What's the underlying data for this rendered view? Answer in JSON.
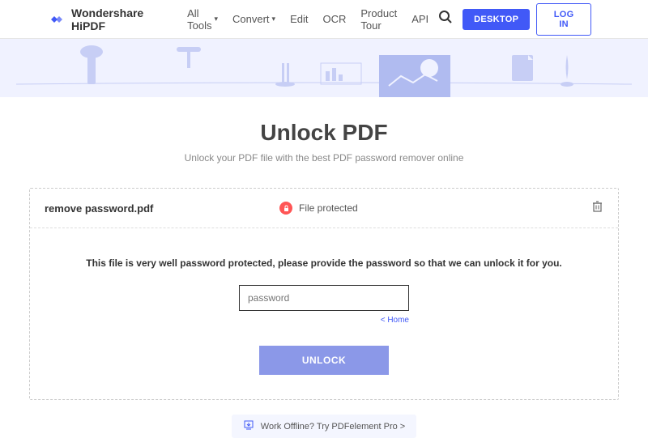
{
  "header": {
    "brand": "Wondershare HiPDF",
    "nav": {
      "all_tools": "All Tools",
      "convert": "Convert",
      "edit": "Edit",
      "ocr": "OCR",
      "product_tour": "Product Tour",
      "api": "API"
    },
    "desktop_btn": "DESKTOP",
    "login_btn": "LOG IN"
  },
  "page": {
    "title": "Unlock PDF",
    "subtitle": "Unlock your PDF file with the best PDF password remover online"
  },
  "file": {
    "name": "remove password.pdf",
    "status": "File protected",
    "prompt": "This file is very well password protected, please provide the password so that we can unlock it for you.",
    "password_placeholder": "password",
    "home_link": "< Home",
    "unlock_btn": "UNLOCK"
  },
  "offline": {
    "text": "Work Offline? Try PDFelement Pro >"
  }
}
